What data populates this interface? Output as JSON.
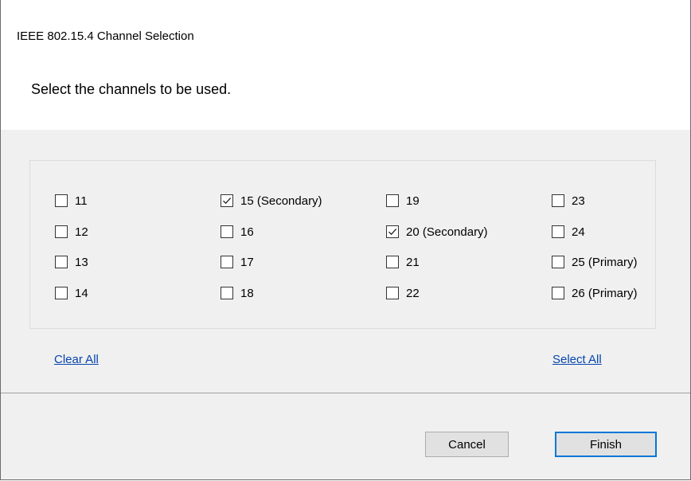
{
  "dialog": {
    "title": "IEEE 802.15.4 Channel Selection",
    "instruction": "Select the channels to be used."
  },
  "channels": [
    {
      "label": "11",
      "checked": false
    },
    {
      "label": "12",
      "checked": false
    },
    {
      "label": "13",
      "checked": false
    },
    {
      "label": "14",
      "checked": false
    },
    {
      "label": "15 (Secondary)",
      "checked": true
    },
    {
      "label": "16",
      "checked": false
    },
    {
      "label": "17",
      "checked": false
    },
    {
      "label": "18",
      "checked": false
    },
    {
      "label": "19",
      "checked": false
    },
    {
      "label": "20 (Secondary)",
      "checked": true
    },
    {
      "label": "21",
      "checked": false
    },
    {
      "label": "22",
      "checked": false
    },
    {
      "label": "23",
      "checked": false
    },
    {
      "label": "24",
      "checked": false
    },
    {
      "label": "25 (Primary)",
      "checked": false
    },
    {
      "label": "26 (Primary)",
      "checked": false
    }
  ],
  "links": {
    "clear_all": "Clear All",
    "select_all": "Select All"
  },
  "buttons": {
    "cancel": "Cancel",
    "finish": "Finish"
  },
  "colors": {
    "link": "#0645ad",
    "default_button_border": "#0078d7",
    "panel_background": "#f0f0f0"
  }
}
